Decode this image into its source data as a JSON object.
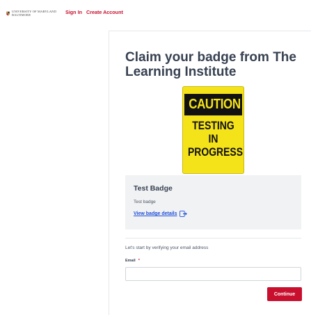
{
  "header": {
    "logo_line1": "University of Maryland",
    "logo_line2": "Baltimore",
    "sign_in": "Sign In",
    "create_account": "Create Account",
    "brand_color": "#c8102e"
  },
  "claim": {
    "title": "Claim your badge from The Learning Institute"
  },
  "badge_image": {
    "header": "CAUTION",
    "lines": [
      "TESTING",
      "IN",
      "PROGRESS"
    ],
    "sign_color": "#f5e31a"
  },
  "badge": {
    "name": "Test Badge",
    "description": "Test badge",
    "details_link": "View badge details",
    "details_icon": "external-link-icon",
    "link_color": "#1d4ed8"
  },
  "form": {
    "prompt": "Let's start by verifying your email address",
    "email_label": "Email",
    "required_mark": "*",
    "email_value": "",
    "continue_label": "Continue"
  }
}
